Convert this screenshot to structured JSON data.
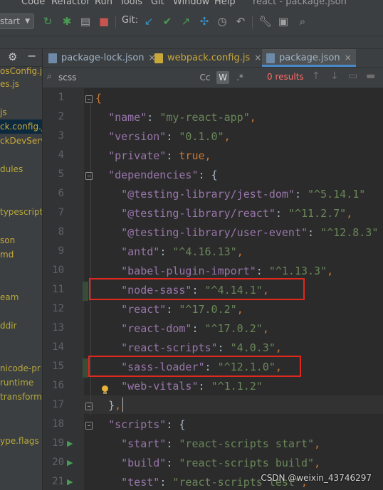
{
  "window": {
    "title": "react - package.json"
  },
  "menu": [
    "Refactor",
    "Run",
    "Tools",
    "Git",
    "Window",
    "Help"
  ],
  "menu_partial": [
    "Code"
  ],
  "toolbar": {
    "run_config": "start",
    "git_label": "Git:"
  },
  "project_panel": {
    "items": [
      "osConfig.js",
      "es.js",
      "",
      "js",
      "ck.config.js",
      "ckDevServ",
      "",
      "dules",
      "",
      "typescript",
      "",
      "son",
      "md",
      "",
      "",
      "eam",
      "",
      "ddir",
      "",
      "nicode-pr",
      "runtime",
      "transform",
      "",
      "ype.flags"
    ]
  },
  "tabs": [
    {
      "label": "package-lock.json",
      "close": "×"
    },
    {
      "label": "webpack.config.js",
      "close": "×"
    },
    {
      "label": "package.json",
      "close": "×",
      "active": true
    }
  ],
  "search": {
    "value": "scss",
    "cc": "Cc",
    "w": "W",
    "regex": ".*",
    "results": "0 results"
  },
  "editor": {
    "line_numbers": [
      "1",
      "2",
      "3",
      "4",
      "5",
      "6",
      "7",
      "8",
      "9",
      "10",
      "11",
      "12",
      "13",
      "14",
      "15",
      "16",
      "17",
      "18",
      "19",
      "20",
      "21"
    ],
    "lines": [
      {
        "indent": "",
        "tokens": [
          [
            "b",
            "{"
          ]
        ]
      },
      {
        "indent": "  ",
        "tokens": [
          [
            "k",
            "\"name\""
          ],
          [
            "p",
            ": "
          ],
          [
            "s",
            "\"my-react-app\""
          ],
          [
            "b",
            ","
          ]
        ]
      },
      {
        "indent": "  ",
        "tokens": [
          [
            "k",
            "\"version\""
          ],
          [
            "p",
            ": "
          ],
          [
            "s",
            "\"0.1.0\""
          ],
          [
            "b",
            ","
          ]
        ]
      },
      {
        "indent": "  ",
        "tokens": [
          [
            "k",
            "\"private\""
          ],
          [
            "p",
            ": "
          ],
          [
            "kw",
            "true"
          ],
          [
            "b",
            ","
          ]
        ]
      },
      {
        "indent": "  ",
        "tokens": [
          [
            "k",
            "\"dependencies\""
          ],
          [
            "p",
            ": "
          ],
          [
            "p",
            "{"
          ]
        ]
      },
      {
        "indent": "    ",
        "tokens": [
          [
            "k",
            "\"@testing-library/jest-dom\""
          ],
          [
            "p",
            ": "
          ],
          [
            "s",
            "\"^5.14.1\""
          ]
        ]
      },
      {
        "indent": "    ",
        "tokens": [
          [
            "k",
            "\"@testing-library/react\""
          ],
          [
            "p",
            ": "
          ],
          [
            "s",
            "\"^11.2.7\""
          ],
          [
            "b",
            ","
          ]
        ]
      },
      {
        "indent": "    ",
        "tokens": [
          [
            "k",
            "\"@testing-library/user-event\""
          ],
          [
            "p",
            ": "
          ],
          [
            "s",
            "\"^12.8.3\""
          ]
        ]
      },
      {
        "indent": "    ",
        "tokens": [
          [
            "k",
            "\"antd\""
          ],
          [
            "p",
            ": "
          ],
          [
            "s",
            "\"^4.16.13\""
          ],
          [
            "b",
            ","
          ]
        ]
      },
      {
        "indent": "    ",
        "tokens": [
          [
            "k",
            "\"babel-plugin-import\""
          ],
          [
            "p",
            ": "
          ],
          [
            "s",
            "\"^1.13.3\""
          ],
          [
            "b",
            ","
          ]
        ]
      },
      {
        "indent": "    ",
        "tokens": [
          [
            "k",
            "\"node-sass\""
          ],
          [
            "p",
            ": "
          ],
          [
            "s",
            "\"^4.14.1\""
          ],
          [
            "b",
            ","
          ]
        ]
      },
      {
        "indent": "    ",
        "tokens": [
          [
            "k",
            "\"react\""
          ],
          [
            "p",
            ": "
          ],
          [
            "s",
            "\"^17.0.2\""
          ],
          [
            "b",
            ","
          ]
        ]
      },
      {
        "indent": "    ",
        "tokens": [
          [
            "k",
            "\"react-dom\""
          ],
          [
            "p",
            ": "
          ],
          [
            "s",
            "\"^17.0.2\""
          ],
          [
            "b",
            ","
          ]
        ]
      },
      {
        "indent": "    ",
        "tokens": [
          [
            "k",
            "\"react-scripts\""
          ],
          [
            "p",
            ": "
          ],
          [
            "s",
            "\"4.0.3\""
          ],
          [
            "b",
            ","
          ]
        ]
      },
      {
        "indent": "    ",
        "tokens": [
          [
            "k",
            "\"sass-loader\""
          ],
          [
            "p",
            ": "
          ],
          [
            "s",
            "\"^12.1.0\""
          ],
          [
            "b",
            ","
          ]
        ]
      },
      {
        "indent": "    ",
        "tokens": [
          [
            "k",
            "\"web-vitals\""
          ],
          [
            "p",
            ": "
          ],
          [
            "s",
            "\"^1.1.2\""
          ]
        ]
      },
      {
        "indent": "  ",
        "tokens": [
          [
            "p",
            "}"
          ],
          [
            "b",
            ","
          ]
        ]
      },
      {
        "indent": "  ",
        "tokens": [
          [
            "k",
            "\"scripts\""
          ],
          [
            "p",
            ": "
          ],
          [
            "p",
            "{"
          ]
        ]
      },
      {
        "indent": "    ",
        "tokens": [
          [
            "k",
            "\"start\""
          ],
          [
            "p",
            ": "
          ],
          [
            "s",
            "\"react-scripts start\""
          ],
          [
            "b",
            ","
          ]
        ]
      },
      {
        "indent": "    ",
        "tokens": [
          [
            "k",
            "\"build\""
          ],
          [
            "p",
            ": "
          ],
          [
            "s",
            "\"react-scripts build\""
          ],
          [
            "b",
            ","
          ]
        ]
      },
      {
        "indent": "    ",
        "tokens": [
          [
            "k",
            "\"test\""
          ],
          [
            "p",
            ": "
          ],
          [
            "s",
            "\"react-scripts test\""
          ],
          [
            "b",
            ","
          ]
        ]
      }
    ]
  },
  "watermark": "CSDN @weixin_43746297",
  "colors": {
    "highlight_box": "#e0281d",
    "accent": "#4a88c7",
    "json_key": "#9876aa",
    "json_string": "#6a8759"
  }
}
